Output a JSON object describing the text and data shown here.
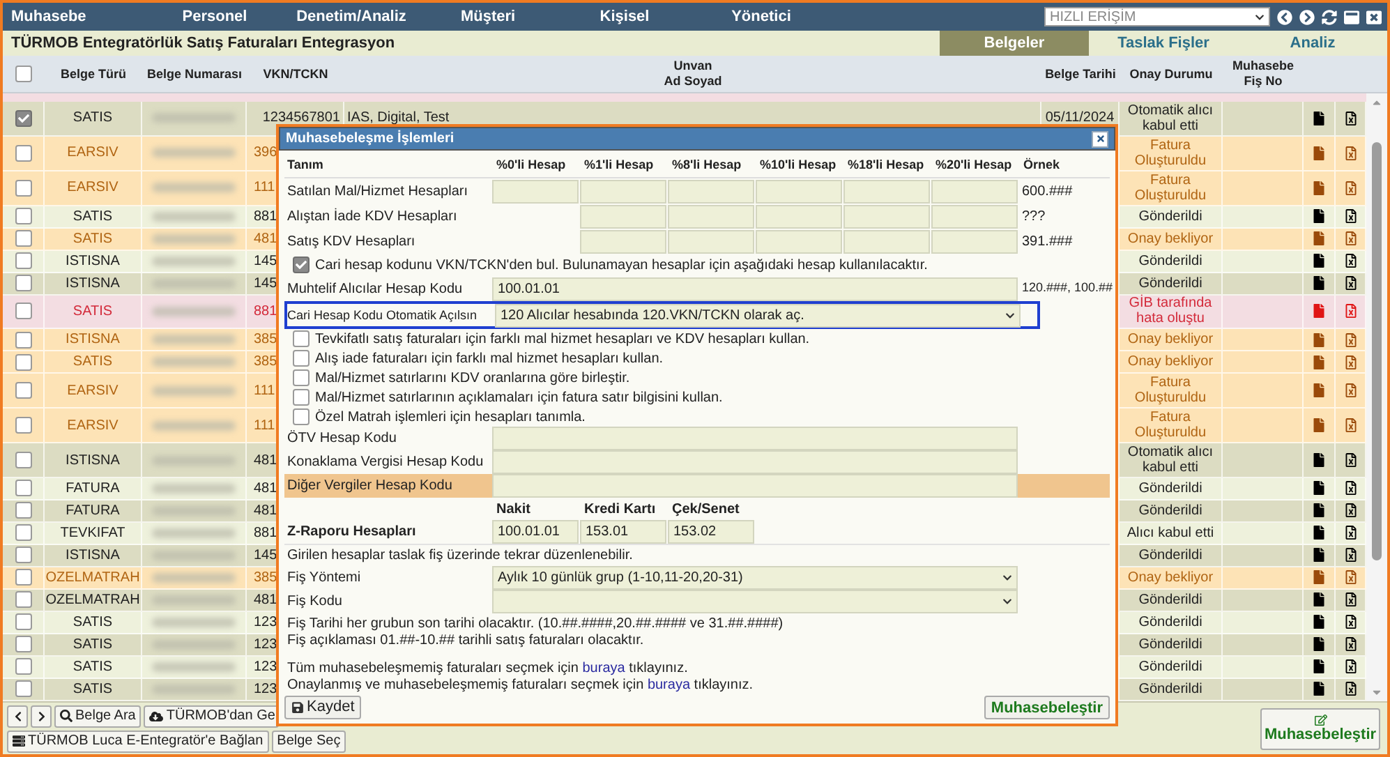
{
  "menu": [
    "Muhasebe",
    "Personel",
    "Denetim/Analiz",
    "Müşteri",
    "Kişisel",
    "Yönetici"
  ],
  "quick_access": {
    "value": "HIZLI ERİŞİM"
  },
  "page_title": "TÜRMOB Entegratörlük Satış Faturaları Entegrasyon",
  "tabs": [
    {
      "label": "Belgeler",
      "selected": true
    },
    {
      "label": "Taslak Fişler",
      "selected": false
    },
    {
      "label": "Analiz",
      "selected": false
    }
  ],
  "table": {
    "select_all": {
      "checked": false
    },
    "columns": [
      "Belge Türü",
      "Belge Numarası",
      "VKN/TCKN",
      "Unvan\nAd Soyad",
      "Belge Tarihi",
      "Onay Durumu",
      "Muhasebe\nFiş No"
    ],
    "rows": [
      {
        "checked": true,
        "type": "SATIS",
        "vkn": "1234567801",
        "name": "IAS, Digital, Test",
        "date": "05/11/2024",
        "status": "Otomatik alıcı kabul etti",
        "kind": "normal"
      },
      {
        "checked": false,
        "type": "EARSIV",
        "vkn": "396",
        "status": "Fatura Oluşturuldu",
        "kind": "warning"
      },
      {
        "checked": false,
        "type": "EARSIV",
        "vkn": "111",
        "status": "Fatura Oluşturuldu",
        "kind": "warning"
      },
      {
        "checked": false,
        "type": "SATIS",
        "vkn": "881",
        "status": "Gönderildi",
        "kind": "normal"
      },
      {
        "checked": false,
        "type": "SATIS",
        "vkn": "481",
        "status": "Onay bekliyor",
        "kind": "warning"
      },
      {
        "checked": false,
        "type": "ISTISNA",
        "vkn": "145",
        "status": "Gönderildi",
        "kind": "normal"
      },
      {
        "checked": false,
        "type": "ISTISNA",
        "vkn": "145",
        "status": "Gönderildi",
        "kind": "normal"
      },
      {
        "checked": false,
        "type": "SATIS",
        "vkn": "881",
        "status": "GİB tarafında hata oluştu",
        "kind": "error"
      },
      {
        "checked": false,
        "type": "ISTISNA",
        "vkn": "385",
        "status": "Onay bekliyor",
        "kind": "warning"
      },
      {
        "checked": false,
        "type": "SATIS",
        "vkn": "385",
        "status": "Onay bekliyor",
        "kind": "warning"
      },
      {
        "checked": false,
        "type": "EARSIV",
        "vkn": "111",
        "status": "Fatura Oluşturuldu",
        "kind": "warning"
      },
      {
        "checked": false,
        "type": "EARSIV",
        "vkn": "111",
        "status": "Fatura Oluşturuldu",
        "kind": "warning"
      },
      {
        "checked": false,
        "type": "ISTISNA",
        "vkn": "481",
        "status": "Otomatik alıcı kabul etti",
        "kind": "normal"
      },
      {
        "checked": false,
        "type": "FATURA",
        "vkn": "481",
        "status": "Gönderildi",
        "kind": "normal"
      },
      {
        "checked": false,
        "type": "FATURA",
        "vkn": "481",
        "status": "Gönderildi",
        "kind": "normal"
      },
      {
        "checked": false,
        "type": "TEVKIFAT",
        "vkn": "881",
        "status": "Alıcı kabul etti",
        "kind": "normal"
      },
      {
        "checked": false,
        "type": "ISTISNA",
        "vkn": "145",
        "status": "Gönderildi",
        "kind": "normal"
      },
      {
        "checked": false,
        "type": "OZELMATRAH",
        "vkn": "385",
        "status": "Onay bekliyor",
        "kind": "warning"
      },
      {
        "checked": false,
        "type": "OZELMATRAH",
        "vkn": "481",
        "status": "Gönderildi",
        "kind": "normal"
      },
      {
        "checked": false,
        "type": "SATIS",
        "vkn": "123",
        "status": "Gönderildi",
        "kind": "normal"
      },
      {
        "checked": false,
        "type": "SATIS",
        "vkn": "123",
        "status": "Gönderildi",
        "kind": "normal"
      },
      {
        "checked": false,
        "type": "SATIS",
        "vkn": "123",
        "status": "Gönderildi",
        "kind": "normal"
      },
      {
        "checked": false,
        "type": "SATIS",
        "vkn": "123",
        "status": "Gönderildi",
        "kind": "normal"
      }
    ]
  },
  "toolbar": {
    "search_button": "Belge Ara",
    "download_button": "TÜRMOB'dan Ge",
    "connect_button": "TÜRMOB Luca E-Entegratör'e Bağlan",
    "select_button": "Belge Seç",
    "post_button": "Muhasebeleştir"
  },
  "dialog": {
    "title": "Muhasebeleşme İşlemleri",
    "account_table": {
      "columns": [
        "Tanım",
        "%0'li Hesap",
        "%1'li Hesap",
        "%8'li Hesap",
        "%10'li Hesap",
        "%18'li Hesap",
        "%20'li Hesap",
        "Örnek"
      ],
      "rows": [
        {
          "label": "Satılan Mal/Hizmet Hesapları",
          "kind": "full",
          "example": "600.###"
        },
        {
          "label": "Alıştan İade KDV Hesapları",
          "kind": "partial",
          "example": "???"
        },
        {
          "label": "Satış KDV Hesapları",
          "kind": "partial",
          "example": "391.###"
        }
      ]
    },
    "vkn_lookup": {
      "label": "Cari hesap kodunu VKN/TCKN'den bul. Bulunamayan hesaplar için aşağıdaki hesap kullanılacaktır.",
      "checked": true
    },
    "misc_account": {
      "label": "Muhtelif Alıcılar Hesap Kodu",
      "value": "100.01.01",
      "example": "120.###, 100.##"
    },
    "auto_open": {
      "label": "Cari Hesap Kodu Otomatik Açılsın",
      "value": "120 Alıcılar hesabında 120.VKN/TCKN olarak aç.",
      "highlighted": true
    },
    "options": [
      {
        "label": "Tevkifatlı satış faturaları için farklı mal hizmet hesapları ve KDV hesapları kullan.",
        "checked": false
      },
      {
        "label": "Alış iade faturaları için farklı mal hizmet hesapları kullan.",
        "checked": false
      },
      {
        "label": "Mal/Hizmet satırlarını KDV oranlarına göre birleştir.",
        "checked": false
      },
      {
        "label": "Mal/Hizmet satırlarının açıklamaları için fatura satır bilgisini kullan.",
        "checked": false
      },
      {
        "label": "Özel Matrah işlemleri için hesapları tanımla.",
        "checked": false
      }
    ],
    "tax_accounts": [
      {
        "label": "ÖTV Hesap Kodu",
        "highlighted": false
      },
      {
        "label": "Konaklama Vergisi Hesap Kodu",
        "highlighted": false
      },
      {
        "label": "Diğer Vergiler Hesap Kodu",
        "highlighted": true
      }
    ],
    "z_report": {
      "label": "Z-Raporu Hesapları",
      "columns": [
        "Nakit",
        "Kredi Kartı",
        "Çek/Senet"
      ],
      "values": [
        "100.01.01",
        "153.01",
        "153.02"
      ]
    },
    "note": "Girilen hesaplar taslak fiş üzerinde tekrar düzenlenebilir.",
    "voucher_method": {
      "label": "Fiş Yöntemi",
      "value": "Aylık 10 günlük grup (1-10,11-20,20-31)"
    },
    "voucher_code": {
      "label": "Fiş Kodu"
    },
    "info_lines": [
      "Fiş Tarihi her grubun son tarihi olacaktır. (10.##.####,20.##.#### ve 31.##.####)",
      "Fiş açıklaması 01.##-10.## tarihli satış faturaları olacaktır."
    ],
    "select_links": [
      {
        "before": "Tüm muhasebeleşmemiş faturaları seçmek için",
        "link": "buraya",
        "after": "tıklayınız."
      },
      {
        "before": "Onaylanmış ve muhasebeleşmemiş faturaları seçmek için",
        "link": "buraya",
        "after": "tıklayınız."
      }
    ],
    "save_button": "Kaydet",
    "submit_button": "Muhasebeleştir"
  }
}
